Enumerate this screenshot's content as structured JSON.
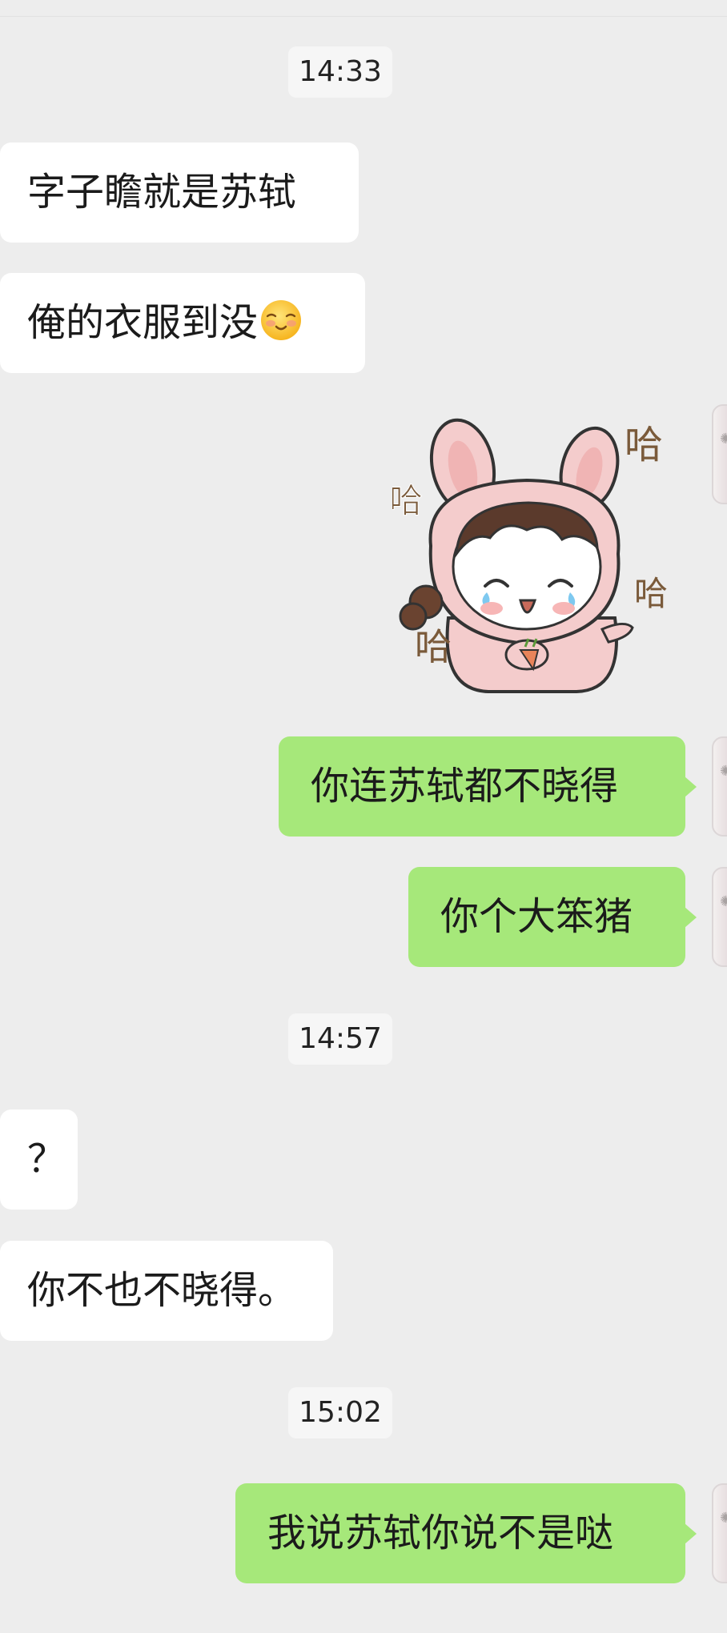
{
  "colors": {
    "background": "#ededed",
    "incoming_bubble": "#ffffff",
    "outgoing_bubble": "#a6e87a",
    "timestamp_bg": "#f6f6f6"
  },
  "messages": [
    {
      "type": "timestamp",
      "text": "14:33"
    },
    {
      "type": "incoming",
      "text": "字子瞻就是苏轼"
    },
    {
      "type": "incoming",
      "text": "俺的衣服到没",
      "emoji": "blushing-smile-emoji"
    },
    {
      "type": "outgoing_sticker",
      "sticker": "bunny-hat-girl-laughing-sticker",
      "sticker_text": [
        "哈",
        "哈",
        "哈",
        "哈"
      ]
    },
    {
      "type": "outgoing",
      "text": "你连苏轼都不晓得"
    },
    {
      "type": "outgoing",
      "text": "你个大笨猪"
    },
    {
      "type": "timestamp",
      "text": "14:57"
    },
    {
      "type": "incoming",
      "text": "？"
    },
    {
      "type": "incoming",
      "text": "你不也不晓得。"
    },
    {
      "type": "timestamp",
      "text": "15:02"
    },
    {
      "type": "outgoing",
      "text": "我说苏轼你说不是哒"
    }
  ]
}
